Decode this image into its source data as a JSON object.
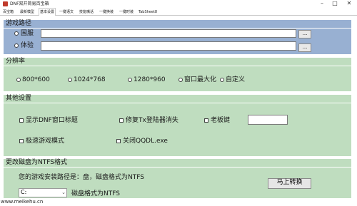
{
  "window": {
    "title": "DNF双开简易百宝箱",
    "minimize": "–",
    "maximize": "□",
    "close": "✕"
  },
  "tabs": [
    "百宝箱",
    "最新模型",
    "基本设置",
    "一键语文",
    "技能嘴话",
    "一键换装",
    "一键时装",
    "TabSheet8"
  ],
  "panels": {
    "path": {
      "legend": "游戏路径",
      "rows": [
        {
          "label": "国服",
          "value": "",
          "browse": "..."
        },
        {
          "label": "体验",
          "value": "",
          "browse": "..."
        }
      ]
    },
    "resolution": {
      "legend": "分辨率",
      "options": [
        "800*600",
        "1024*768",
        "1280*960",
        "窗口最大化",
        "自定义"
      ]
    },
    "other": {
      "legend": "其他设置",
      "checkboxes": [
        "显示DNF窗口标题",
        "修复Tx登陆器消失",
        "老板键",
        "极速游戏模式",
        "关闭QQDL.exe"
      ],
      "boss_key_value": ""
    },
    "ntfs": {
      "legend": "更改磁盘为NTFS格式",
      "info": "您的游戏安装路径是：盘，磁盘格式为NTFS",
      "drive": "C:",
      "format_text": "磁盘格式为NTFS",
      "convert_button": "马上转换"
    }
  },
  "watermark": "www.meikehu.cn"
}
